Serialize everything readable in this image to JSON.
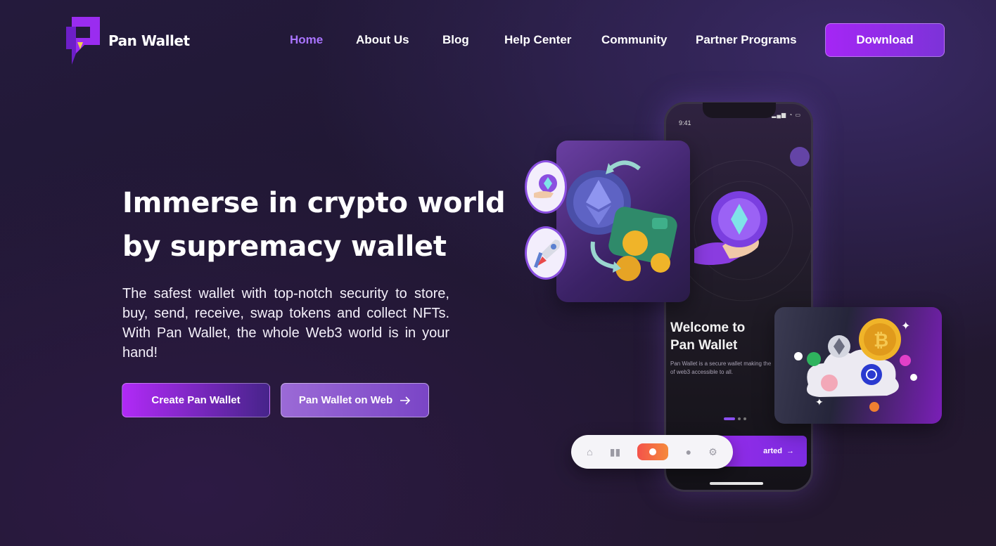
{
  "brand": {
    "name": "Pan Wallet",
    "accent": "#a526f5",
    "active_link": "#a974ff"
  },
  "nav": {
    "items": [
      {
        "label": "Home",
        "active": true
      },
      {
        "label": "About Us"
      },
      {
        "label": "Blog"
      },
      {
        "label": "Help Center"
      },
      {
        "label": "Community"
      },
      {
        "label": "Partner Programs"
      }
    ],
    "download_label": "Download"
  },
  "hero": {
    "title_line1": "Immerse in crypto world",
    "title_line2": "by supremacy wallet",
    "subtitle": "The safest wallet with top-notch security to store, buy, send, receive, swap tokens and collect NFTs. With Pan Wallet, the whole Web3 world is in your hand!",
    "primary_button": "Create Pan Wallet",
    "secondary_button": "Pan Wallet on Web",
    "secondary_icon": "arrow-right-icon"
  },
  "phone": {
    "time": "9:41",
    "welcome_line1": "Welcome to",
    "welcome_line2": "Pan Wallet",
    "description": "Pan Wallet is a secure wallet making the of web3 accessible to all.",
    "cta_label": "arted"
  },
  "tabbar": {
    "icons": [
      "home-icon",
      "chart-icon",
      "wallet-icon",
      "user-icon",
      "gear-icon"
    ]
  }
}
